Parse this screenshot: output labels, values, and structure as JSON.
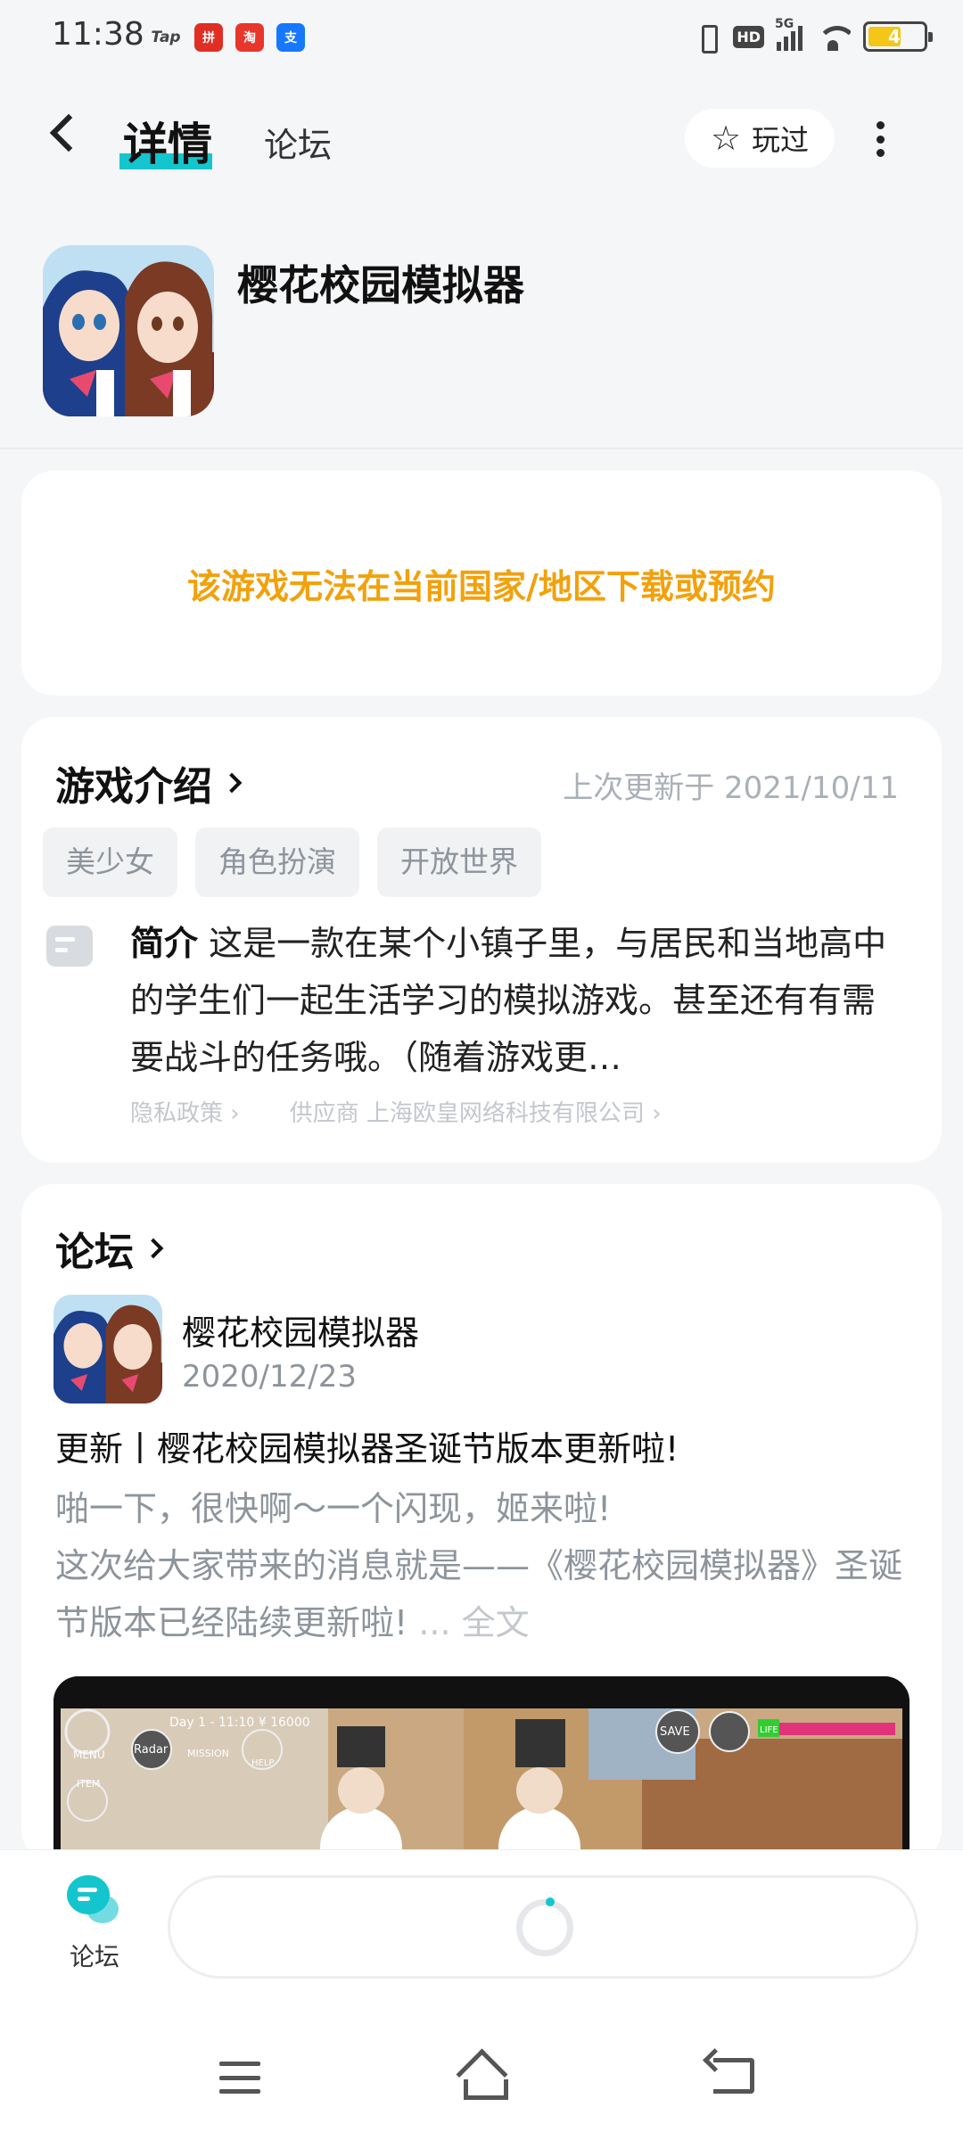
{
  "status_bar": {
    "time": "11:38",
    "apps": [
      "Tap",
      "拼",
      "淘",
      "支"
    ],
    "network": "5G",
    "hd": "HD",
    "battery_level": "4"
  },
  "header": {
    "tab_detail": "详情",
    "tab_forum": "论坛",
    "played_label": "玩过",
    "accent_color": "#15c5ce"
  },
  "game": {
    "title": "樱花校园模拟器"
  },
  "notice": {
    "text": "该游戏无法在当前国家/地区下载或预约",
    "color": "#f2a10b"
  },
  "intro": {
    "title": "游戏介绍",
    "updated": "上次更新于 2021/10/11",
    "tags": [
      "美少女",
      "角色扮演",
      "开放世界"
    ],
    "label": "简介",
    "text": "这是一款在某个小镇子里，与居民和当地高中的学生们一起生活学习的模拟游戏。甚至还有有需要战斗的任务哦。（随着游戏更…",
    "privacy": "隐私政策 ›",
    "supplier": "供应商 上海欧皇网络科技有限公司 ›"
  },
  "forum": {
    "title": "论坛",
    "post": {
      "author": "樱花校园模拟器",
      "date": "2020/12/23",
      "title": "更新丨樱花校园模拟器圣诞节版本更新啦!",
      "body_line1": "啪一下，很快啊～一个闪现，姬来啦!",
      "body_line2": "这次给大家带来的消息就是——《樱花校园模拟器》圣诞节版本已经陆续更新啦!",
      "more": "... 全文"
    },
    "image_hud": {
      "day": "Day 1 - 11:10 ¥ 16000",
      "menu": "MENU",
      "radar": "Radar",
      "mission": "MISSION",
      "help": "HELP",
      "item": "ITEM",
      "save": "SAVE",
      "life": "LIFE"
    }
  },
  "bottom_nav": {
    "forum_label": "论坛"
  }
}
